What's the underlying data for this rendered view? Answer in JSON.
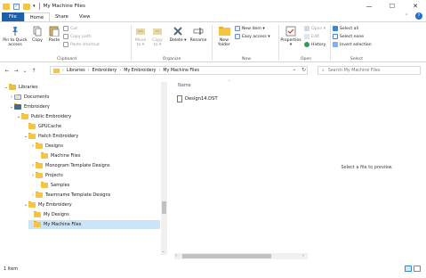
{
  "window": {
    "title": "My Machine Files",
    "minimize": "—",
    "maximize": "☐",
    "close": "✕"
  },
  "menu_tabs": [
    {
      "label": "File"
    },
    {
      "label": "Home"
    },
    {
      "label": "Share"
    },
    {
      "label": "View"
    }
  ],
  "ribbon": {
    "clipboard": {
      "pin": "Pin to Quick access",
      "copy": "Copy",
      "paste": "Paste",
      "cut": "Cut",
      "copy_path": "Copy path",
      "paste_shortcut": "Paste shortcut",
      "label": "Clipboard"
    },
    "organize": {
      "move_to": "Move to ▾",
      "copy_to": "Copy to ▾",
      "delete": "Delete ▾",
      "rename": "Rename",
      "label": "Organize"
    },
    "new": {
      "new_folder": "New folder",
      "new_item": "New item ▾",
      "easy_access": "Easy access ▾",
      "label": "New"
    },
    "open": {
      "properties": "Properties ▾",
      "open": "Open ▾",
      "edit": "Edit",
      "history": "History",
      "label": "Open"
    },
    "select": {
      "select_all": "Select all",
      "select_none": "Select none",
      "invert": "Invert selection",
      "label": "Select"
    }
  },
  "navigation": {
    "back": "←",
    "forward": "→",
    "recent": "⌄",
    "up": "↑",
    "breadcrumbs": [
      {
        "label": "Libraries"
      },
      {
        "label": "Embroidery"
      },
      {
        "label": "My Embroidery"
      },
      {
        "label": "My Machine Files"
      }
    ],
    "refresh": "↻",
    "search_placeholder": "Search My Machine Files"
  },
  "tree": [
    {
      "label": "Libraries",
      "chev": "⌄"
    },
    {
      "label": "Documents",
      "chev": "›"
    },
    {
      "label": "Embroidery",
      "chev": "⌄"
    },
    {
      "label": "Public Embroidery",
      "chev": "⌄"
    },
    {
      "label": "GPUCache",
      "chev": ""
    },
    {
      "label": "Hatch Embroidery",
      "chev": "⌄"
    },
    {
      "label": "Designs",
      "chev": "›"
    },
    {
      "label": "Machine Files",
      "chev": ""
    },
    {
      "label": "Monogram Template Designs",
      "chev": "›"
    },
    {
      "label": "Projects",
      "chev": "›"
    },
    {
      "label": "Samples",
      "chev": ""
    },
    {
      "label": "Teamname Template Designs",
      "chev": "›"
    },
    {
      "label": "My Embroidery",
      "chev": "⌄"
    },
    {
      "label": "My Designs",
      "chev": ""
    },
    {
      "label": "My Machine Files",
      "chev": ""
    }
  ],
  "files": {
    "column_name": "Name",
    "items": [
      {
        "name": "Design14.DST"
      }
    ]
  },
  "preview": {
    "message": "Select a file to preview."
  },
  "status": {
    "count": "1 item"
  }
}
